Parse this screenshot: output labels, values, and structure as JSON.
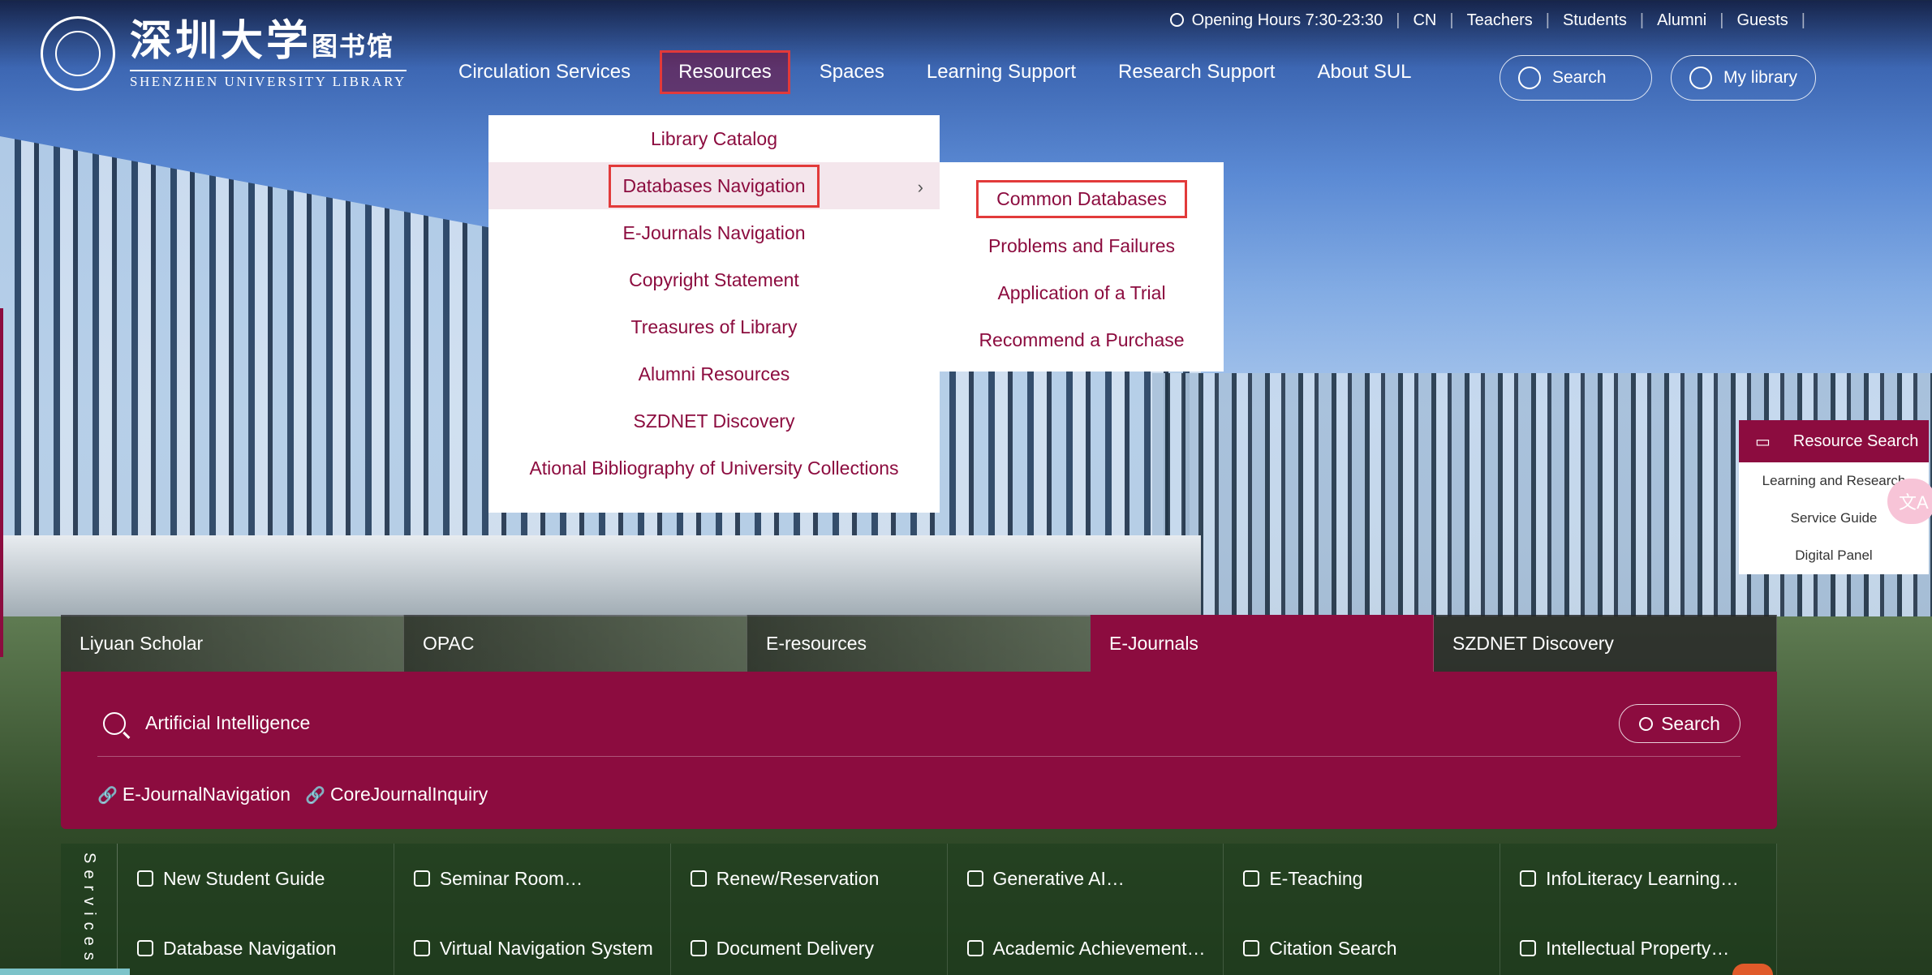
{
  "header": {
    "logo_cn": "深圳大学",
    "logo_cn_small": "图书馆",
    "logo_en": "SHENZHEN UNIVERSITY LIBRARY",
    "topbar": [
      "Opening Hours 7:30-23:30",
      "CN",
      "Teachers",
      "Students",
      "Alumni",
      "Guests"
    ],
    "nav": [
      "Circulation Services",
      "Resources",
      "Spaces",
      "Learning Support",
      "Research Support",
      "About SUL"
    ],
    "search_label": "Search",
    "mylibrary_label": "My library"
  },
  "dropdown": {
    "items": [
      "Library Catalog",
      "Databases Navigation",
      "E-Journals Navigation",
      "Copyright Statement",
      "Treasures of Library",
      "Alumni Resources",
      "SZDNET Discovery",
      "Ational Bibliography of University Collections"
    ],
    "submenu": [
      "Common Databases",
      "Problems and Failures",
      "Application of a Trial",
      "Recommend a Purchase"
    ]
  },
  "side_panel": {
    "head": "Resource Search",
    "items": [
      "Learning and Research",
      "Service Guide",
      "Digital Panel"
    ],
    "translate_icon": "文A"
  },
  "search": {
    "tabs": [
      "Liyuan Scholar",
      "OPAC",
      "E-resources",
      "E-Journals",
      "SZDNET Discovery"
    ],
    "active_tab": "E-Journals",
    "query": "Artificial Intelligence",
    "button": "Search",
    "links": [
      "E-JournalNavigation",
      "CoreJournalInquiry"
    ]
  },
  "services": {
    "label": "Services",
    "row1": [
      "New Student Guide",
      "Seminar Room…",
      "Renew/Reservation",
      "Generative AI…",
      "E-Teaching",
      "InfoLiteracy Learning…"
    ],
    "row2": [
      "Database Navigation",
      "Virtual Navigation System",
      "Document Delivery",
      "Academic Achievement…",
      "Citation Search",
      "Intellectual Property…"
    ]
  },
  "colors": {
    "accent": "#8c0c3f",
    "highlight": "#e23a3a"
  }
}
